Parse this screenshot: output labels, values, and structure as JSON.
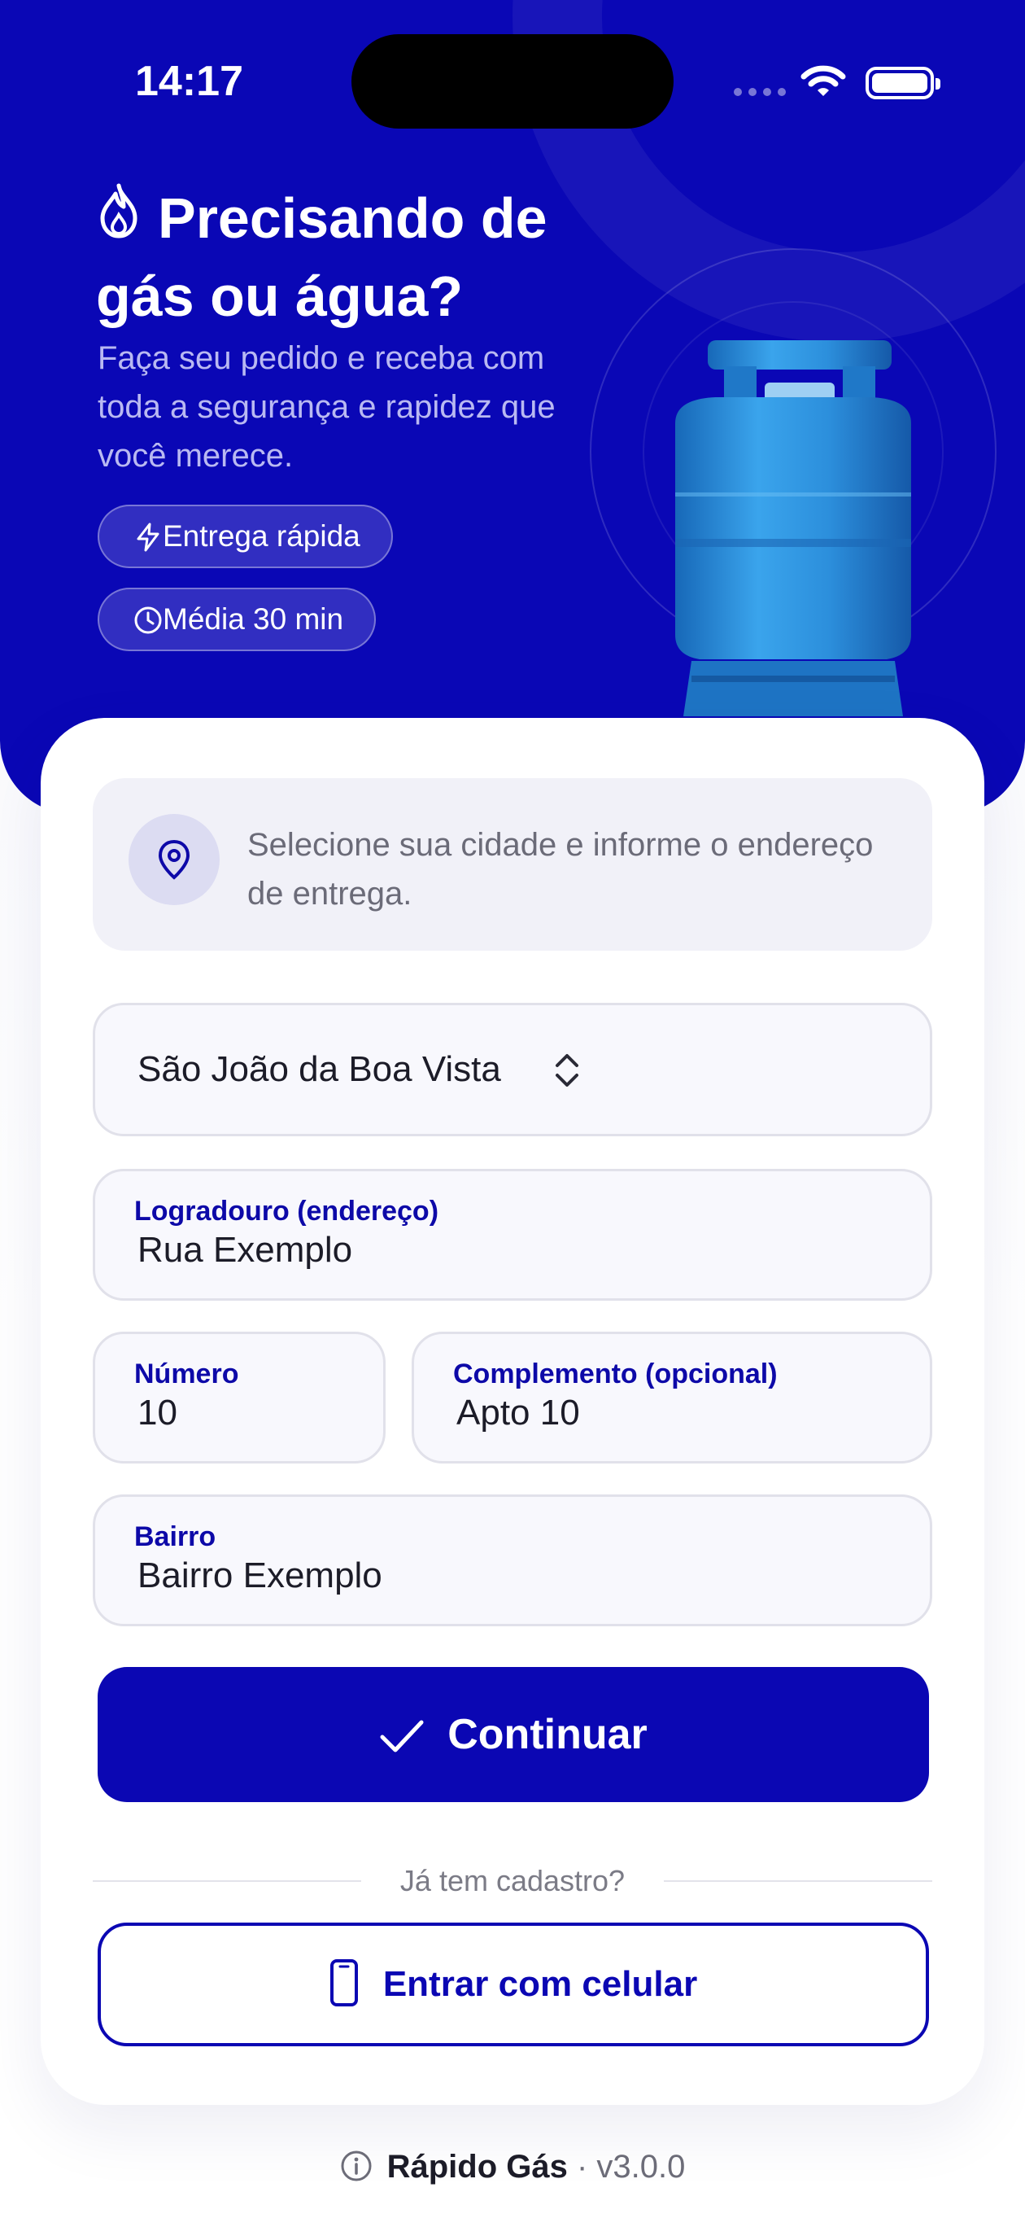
{
  "status_bar": {
    "time": "14:17"
  },
  "hero": {
    "title": "Precisando de gás ou água?",
    "subtitle": "Faça seu pedido e receba com toda a segurança e rapidez que você merece.",
    "chips": [
      {
        "label": "Entrega rápida",
        "icon": "lightning-icon"
      },
      {
        "label": "Média 30 min",
        "icon": "clock-icon"
      }
    ]
  },
  "info": {
    "text": "Selecione sua cidade e informe o endereço de entrega.",
    "icon": "location-pin-icon"
  },
  "form": {
    "city": {
      "value": "São João da Boa Vista"
    },
    "street": {
      "label": "Logradouro (endereço)",
      "value": "Rua Exemplo"
    },
    "number": {
      "label": "Número",
      "value": "10"
    },
    "complement": {
      "label": "Complemento (opcional)",
      "value": "Apto 10"
    },
    "neighborhood": {
      "label": "Bairro",
      "value": "Bairro Exemplo"
    }
  },
  "actions": {
    "continue_label": "Continuar",
    "divider_text": "Já tem cadastro?",
    "phone_login_label": "Entrar com celular"
  },
  "footer": {
    "app_name": "Rápido Gás",
    "version": "· v3.0.0"
  },
  "colors": {
    "primary": "#0b07b3",
    "hero_bg": "#0a07b5",
    "cylinder": "#2f8fd9"
  }
}
